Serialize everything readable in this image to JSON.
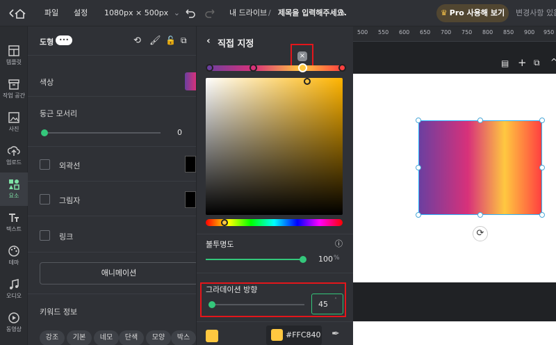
{
  "topbar": {
    "menu_file": "파일",
    "menu_settings": "설정",
    "size_label": "1080px × 500px",
    "breadcrumb_drive": "내 드라이브",
    "breadcrumb_sep": "/",
    "doc_title": "제목을 입력해주세요.",
    "pro_button": "Pro 사용해 보기",
    "save_status": "변경사항 있음"
  },
  "leftnav": [
    {
      "label": "템플릿",
      "icon": "template-icon"
    },
    {
      "label": "작업 공간",
      "icon": "workspace-icon"
    },
    {
      "label": "사진",
      "icon": "photo-icon"
    },
    {
      "label": "업로드",
      "icon": "upload-icon"
    },
    {
      "label": "요소",
      "icon": "elements-icon"
    },
    {
      "label": "텍스트",
      "icon": "text-icon"
    },
    {
      "label": "테마",
      "icon": "theme-icon"
    },
    {
      "label": "오디오",
      "icon": "audio-icon"
    },
    {
      "label": "동영상",
      "icon": "video-icon"
    }
  ],
  "props": {
    "header_label": "도형",
    "more_badge": "•••",
    "color_label": "색상",
    "radius_label": "둥근 모서리",
    "radius_value": "0",
    "outline_label": "외곽선",
    "shadow_label": "그림자",
    "link_label": "링크",
    "animation_button": "애니메이션",
    "keyword_title": "키워드 정보",
    "keywords": [
      "강조",
      "기본",
      "네모",
      "단색",
      "모양",
      "박스"
    ]
  },
  "picker": {
    "title": "직접 지정",
    "remove_stop": "×",
    "opacity_label": "불투명도",
    "opacity_value": "100",
    "opacity_unit": "%",
    "opacity_level": 1.0,
    "gradient_dir_label": "그라데이션 방향",
    "gradient_dir_value": "45",
    "gradient_dir_level": 0.02,
    "hex_value": "#FFC840",
    "swatch_color": "#FFC840"
  },
  "ruler": {
    "ticks": [
      "500",
      "550",
      "600",
      "650",
      "700",
      "750",
      "800",
      "850",
      "900",
      "950"
    ]
  },
  "colors": {
    "accent": "#34C77B",
    "gradient_stops": [
      "#6B3FA0",
      "#D8317A",
      "#FFC840",
      "#FF4040"
    ],
    "highlight": "#E4161B"
  }
}
